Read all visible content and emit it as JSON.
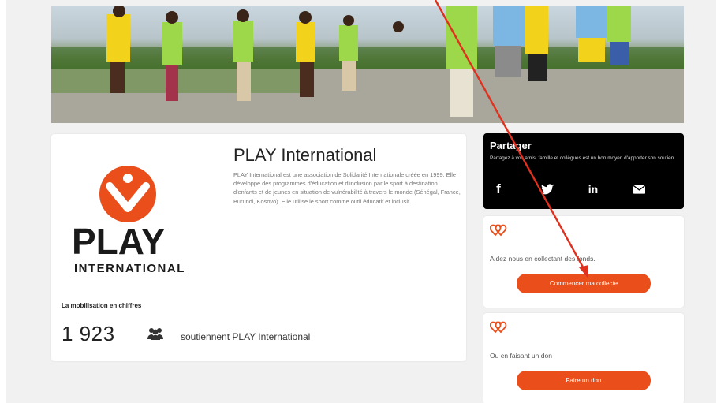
{
  "org": {
    "title": "PLAY International",
    "description": "PLAY International est une association de Solidarité Internationale créée en 1999. Elle développe des programmes d'éducation et d'inclusion par le sport à destination d'enfants et de jeunes en situation de vulnérabilité à travers le monde (Sénégal, France, Burundi, Kosovo). Elle utilise le sport comme outil éducatif et inclusif.",
    "logo_text": "PLAY",
    "logo_subtext": "INTERNATIONAL"
  },
  "stats": {
    "label": "La mobilisation en chiffres",
    "count": "1 923",
    "count_icon": "people-icon",
    "text": "soutiennent PLAY International"
  },
  "share": {
    "title": "Partager",
    "description": "Partagez à vos amis, famille et collègues est un bon moyen d'apporter son soutien",
    "icons": [
      "facebook-icon",
      "twitter-icon",
      "linkedin-icon",
      "mail-icon"
    ],
    "facebook_glyph": "f",
    "linkedin_glyph": "in"
  },
  "fundraise": {
    "icon": "hearts-icon",
    "text": "Aidez nous en collectant des fonds.",
    "button": "Commencer ma collecte"
  },
  "donate": {
    "icon": "hearts-icon",
    "text": "Ou en faisant un don",
    "button": "Faire un don"
  },
  "colors": {
    "accent": "#e94e1b",
    "logo_dark": "#1a1a1a",
    "annotation": "#e0301e",
    "page_bg": "#f1f1f1"
  }
}
